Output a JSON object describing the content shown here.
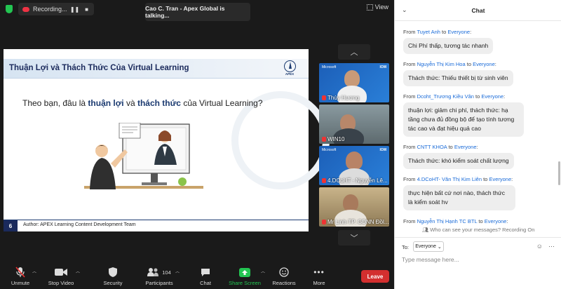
{
  "topbar": {
    "recording_label": "Recording...",
    "talking": "Cao C. Tran - Apex Global is talking...",
    "view_label": "View"
  },
  "slide": {
    "title": "Thuận Lợi và Thách Thức Của Virtual Learning",
    "logo_text": "APEX",
    "question_pre": "Theo bạn, đâu là ",
    "question_hl1": "thuận lợi",
    "question_mid": " và ",
    "question_hl2": "thách thức",
    "question_post": " của Virtual Learning?",
    "number": "6",
    "author": "Author: APEX Learning Content Development Team"
  },
  "gallery": {
    "tiles": [
      {
        "name": "Thùy Hương",
        "muted": true,
        "badge_left": "Microsoft",
        "badge_right": "IOM"
      },
      {
        "name": "WIN10",
        "muted": true,
        "badge_left": "",
        "badge_right": ""
      },
      {
        "name": "4.DCoHT - Nguyễn Lê...",
        "muted": true,
        "badge_left": "Microsoft",
        "badge_right": "IOM"
      },
      {
        "name": "Mr Linh-TP. GDNN Đồl...",
        "muted": true,
        "badge_left": "",
        "badge_right": ""
      }
    ]
  },
  "toolbar": {
    "unmute": "Unmute",
    "stop_video": "Stop Video",
    "security": "Security",
    "participants": "Participants",
    "participants_count": "104",
    "chat": "Chat",
    "share_screen": "Share Screen",
    "reactions": "Reactions",
    "more": "More",
    "leave": "Leave"
  },
  "chat": {
    "title": "Chat",
    "messages": [
      {
        "from_prefix": "From ",
        "sender": "Tuyet Anh",
        "to_word": " to ",
        "recipient": "Everyone",
        "suffix": ":",
        "text": "Chi Phí thấp, tương tác nhanh"
      },
      {
        "from_prefix": "From ",
        "sender": "Nguyễn Thị Kim Hoa",
        "to_word": " to ",
        "recipient": "Everyone",
        "suffix": ":",
        "text": "Thách thức: Thiếu thiết bị từ sinh viên"
      },
      {
        "from_prefix": "From ",
        "sender": "Dcoht_Trương Kiều Vân",
        "to_word": " to ",
        "recipient": "Everyone",
        "suffix": ":",
        "text": "thuận lợi: giảm chi phí, thách thức: hạ tầng chưa đủ đồng bộ để tạo tính tương tác cao và đạt hiệu quả cao"
      },
      {
        "from_prefix": "From ",
        "sender": "CNTT KHOA",
        "to_word": " to ",
        "recipient": "Everyone",
        "suffix": ":",
        "text": "Thách thức: khó kiểm soát chất lượng"
      },
      {
        "from_prefix": "From ",
        "sender": "4.DCoHT- Văn Thị Kim Liên",
        "to_word": " to ",
        "recipient": "Everyone",
        "suffix": ":",
        "text": "thực hiện bất cứ nơi nào, thách thức là kiểm soát hv"
      },
      {
        "from_prefix": "From ",
        "sender": "Nguyễn Thị Hạnh TC BTL",
        "to_word": " to ",
        "recipient": "Everyone",
        "suffix": ":",
        "text": ""
      }
    ],
    "who_can_see": "Who can see your messages? Recording On",
    "to_label": "To:",
    "to_value": "Everyone",
    "placeholder": "Type message here..."
  }
}
